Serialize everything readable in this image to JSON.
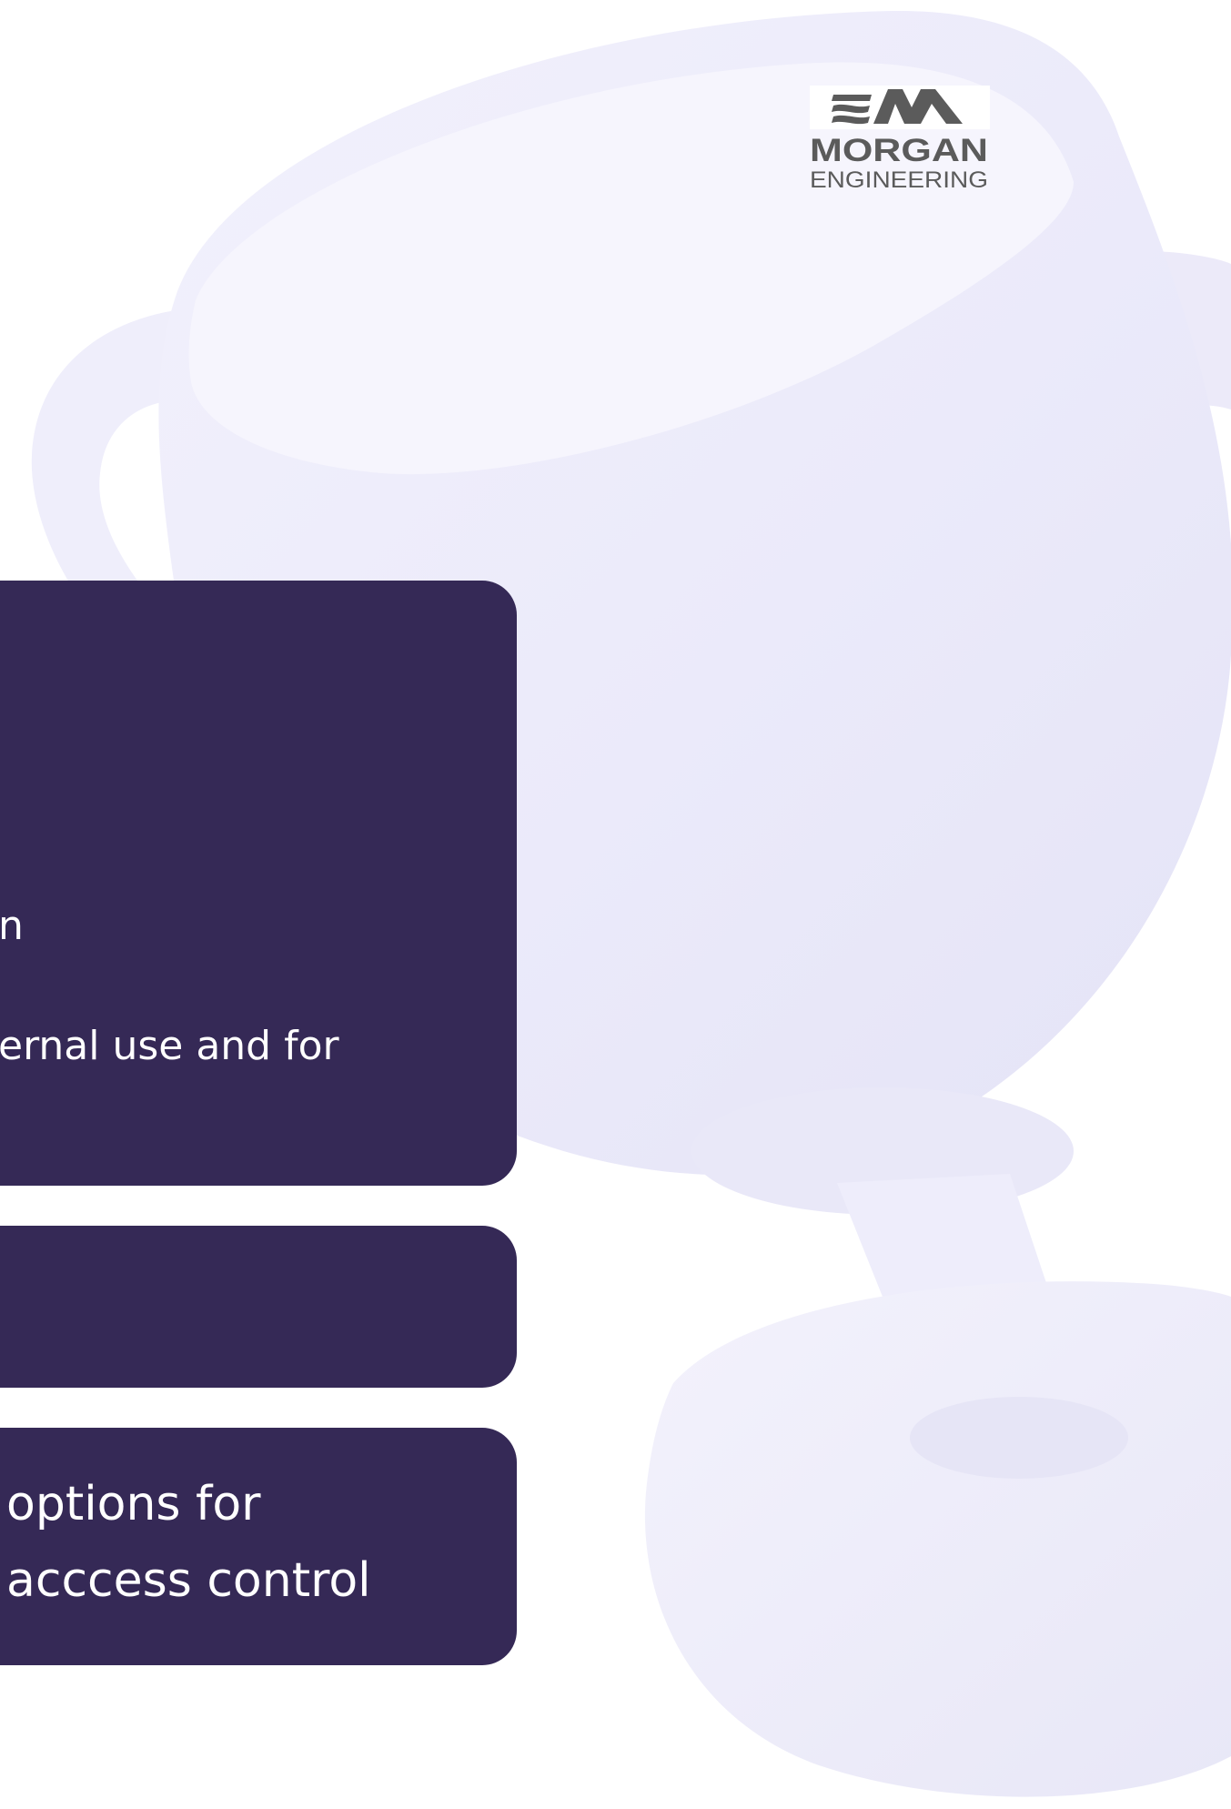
{
  "brand": {
    "logo_word1": "MORGAN",
    "logo_word2": "ENGINEERING",
    "logo_color": "#5b5b5b"
  },
  "colors": {
    "card_bg": "#352956",
    "card_text": "#ffffff",
    "background": "#ffffff",
    "trophy_tint": "#ecebf9"
  },
  "cards": [
    {
      "lines": [
        "n",
        "ernal use and for"
      ]
    },
    {
      "lines": []
    },
    {
      "lines": [
        "options for",
        "acccess control"
      ]
    }
  ],
  "illustration": {
    "icon": "trophy-icon"
  }
}
